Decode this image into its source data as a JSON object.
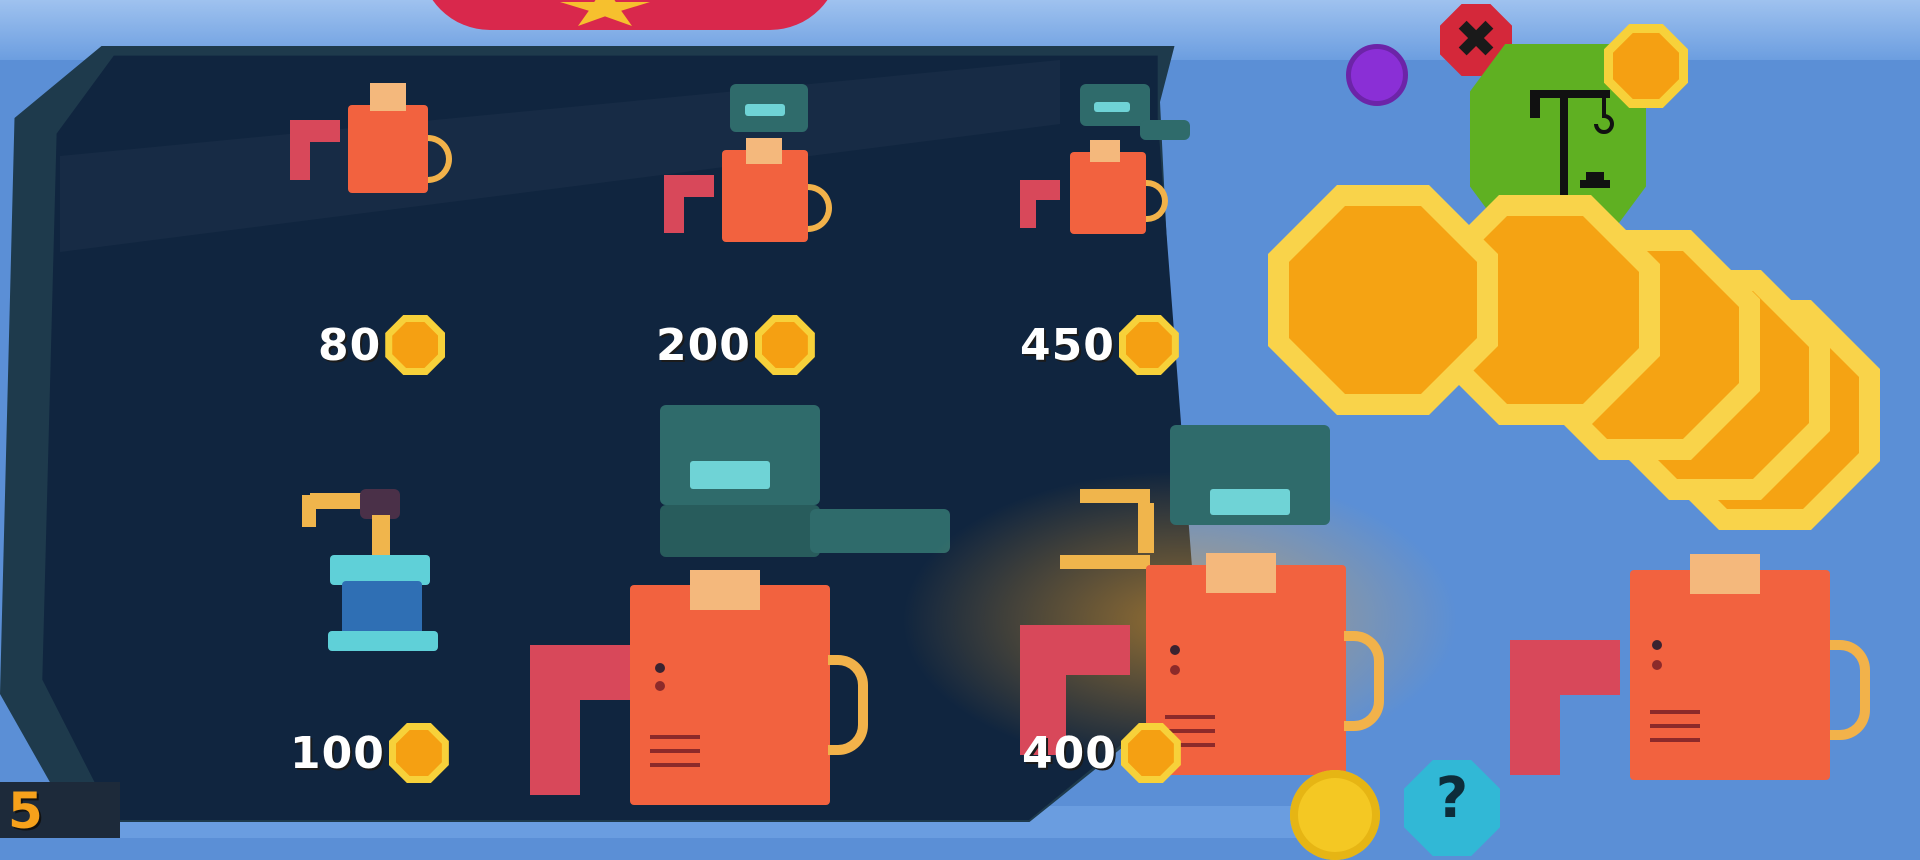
{
  "shop": {
    "items": [
      {
        "price": "80",
        "name": "basic-machine"
      },
      {
        "price": "200",
        "name": "machine-with-head"
      },
      {
        "price": "450",
        "name": "machine-with-robot-arm"
      },
      {
        "price": "100",
        "name": "robot-arm-station"
      },
      {
        "price": "400",
        "name": "advanced-machine"
      }
    ]
  },
  "hud": {
    "close_label": "✖",
    "help_label": "?",
    "level_label": "5"
  },
  "icons": [
    "close-icon",
    "gem-icon",
    "crane-icon",
    "coin-icon",
    "gear-icon",
    "help-icon"
  ],
  "colors": {
    "panel": "#10253f",
    "coin_outer": "#f9d34a",
    "coin_inner": "#f5a313",
    "machine_body": "#f2623f",
    "build_button": "#5fb022",
    "close_button": "#d4283a"
  }
}
